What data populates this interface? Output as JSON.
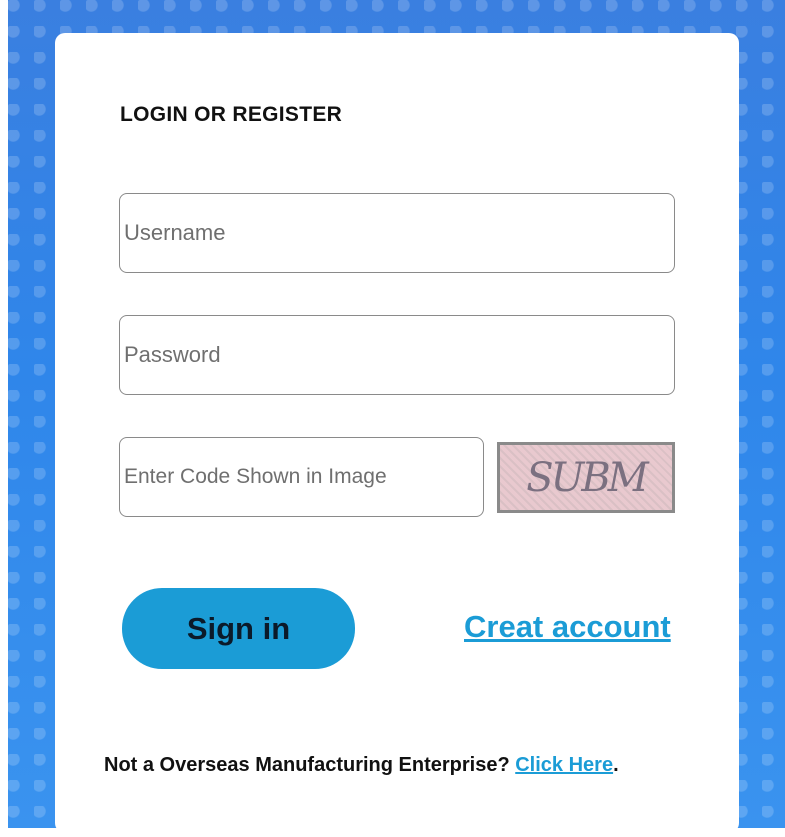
{
  "login": {
    "title": "LOGIN OR REGISTER",
    "username_placeholder": "Username",
    "password_placeholder": "Password",
    "code_placeholder": "Enter Code Shown in Image",
    "captcha_text": "SUBM",
    "signin_label": "Sign in",
    "create_account_label": "Creat account",
    "footer_text": "Not a Overseas Manufacturing Enterprise?",
    "footer_link": "Click Here",
    "footer_end": "."
  },
  "colors": {
    "accent": "#1b9cd6",
    "background": "#2f86ea"
  }
}
